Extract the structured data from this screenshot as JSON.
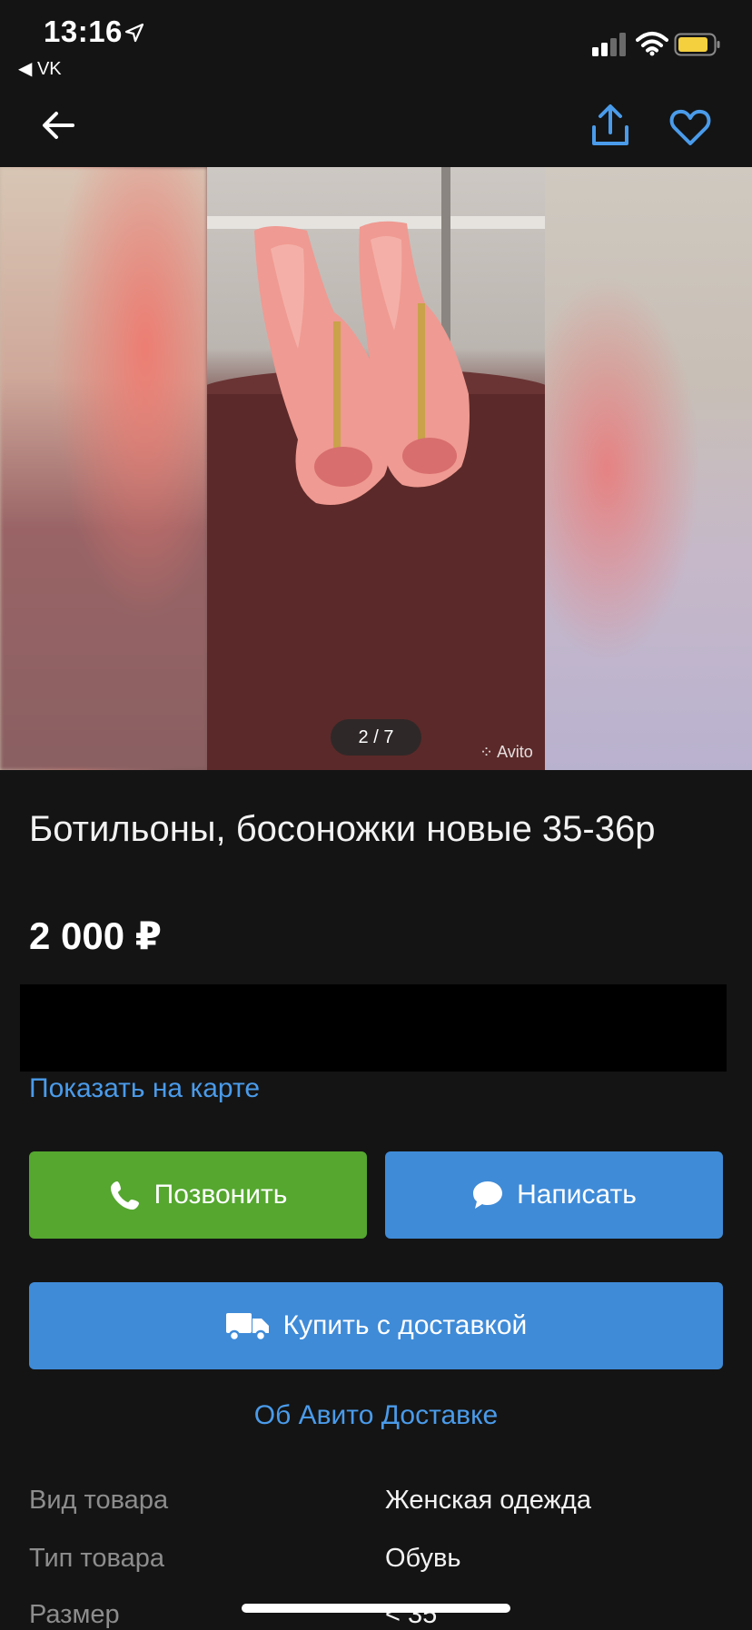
{
  "status_bar": {
    "time": "13:16",
    "back_app": "◀ VK"
  },
  "gallery": {
    "counter": "2 / 7",
    "watermark": "Avito"
  },
  "listing": {
    "title": "Ботильоны, босоножки новые 35-36р",
    "price": "2 000 ₽",
    "map_link": "Показать на карте"
  },
  "actions": {
    "call_label": "Позвонить",
    "write_label": "Написать",
    "buy_label": "Купить с доставкой",
    "about_delivery": "Об Авито Доставке"
  },
  "params": [
    {
      "label": "Вид товара",
      "value": "Женская одежда"
    },
    {
      "label": "Тип товара",
      "value": "Обувь"
    },
    {
      "label": "Размер",
      "value": "< 35"
    }
  ],
  "colors": {
    "background": "#141414",
    "accent_blue": "#3f8bd8",
    "link_blue": "#4a9bea",
    "call_green": "#55a72f"
  }
}
